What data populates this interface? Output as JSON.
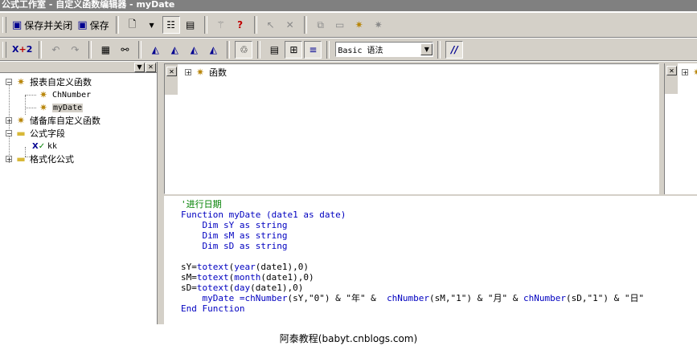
{
  "window": {
    "title": "公式工作室 - 自定义函数编辑器 - myDate"
  },
  "toolbar1": {
    "save_close_label": "保存并关闭",
    "save_label": "保存",
    "icons": [
      "save-icon",
      "save-icon",
      "new-document-icon",
      "tree-view-icon",
      "properties-icon",
      "wand-icon",
      "help-icon"
    ]
  },
  "toolbar2": {
    "language_select": "Basic 语法",
    "icons": [
      "formula-check-icon",
      "undo-icon",
      "redo-icon",
      "browse-icon",
      "find-icon",
      "bookmark-icon",
      "next-bookmark-icon",
      "prev-bookmark-icon",
      "clear-bookmarks-icon",
      "check-syntax-icon",
      "comment-icon",
      "expand-icon",
      "collapse-icon",
      "comment-block-icon"
    ]
  },
  "tree": {
    "items": [
      {
        "label": "报表自定义函数",
        "expander": "−"
      },
      {
        "label": "ChNumber"
      },
      {
        "label": "myDate"
      },
      {
        "label": "储备库自定义函数",
        "expander": "+"
      },
      {
        "label": "公式字段",
        "expander": "−"
      },
      {
        "label": "kk"
      },
      {
        "label": "格式化公式",
        "expander": "+"
      }
    ]
  },
  "functions_pane": {
    "root_label": "函数",
    "expander": "+"
  },
  "operators_pane": {
    "expander": "+"
  },
  "code": {
    "comment": "'进行日期",
    "decl_kw": "Function",
    "decl_rest": " myDate (date1 ",
    "decl_as": "as",
    "decl_type": " date)",
    "dim1": "    Dim sY as string",
    "dim2": "    Dim sM as string",
    "dim3": "    Dim sD as string",
    "sy_a": "sY=",
    "sy_f": "totext",
    "sy_b": "(",
    "sy_g": "year",
    "sy_c": "(date1),0)",
    "sm_a": "sM=",
    "sm_f": "totext",
    "sm_b": "(",
    "sm_g": "month",
    "sm_c": "(date1),0)",
    "sd_a": "sD=",
    "sd_f": "totext",
    "sd_b": "(",
    "sd_g": "day",
    "sd_c": "(date1),0)",
    "ret_a": "    myDate =",
    "ret_f1": "chNumber",
    "ret_b": "(sY,\"0\") & \"年\" &  ",
    "ret_f2": "chNumber",
    "ret_c": "(sM,\"1\") & \"月\" & ",
    "ret_f3": "chNumber",
    "ret_d": "(sD,\"1\") & \"日\"",
    "end": "End Function"
  },
  "footer": {
    "text": "阿泰教程(babyt.cnblogs.com)"
  }
}
